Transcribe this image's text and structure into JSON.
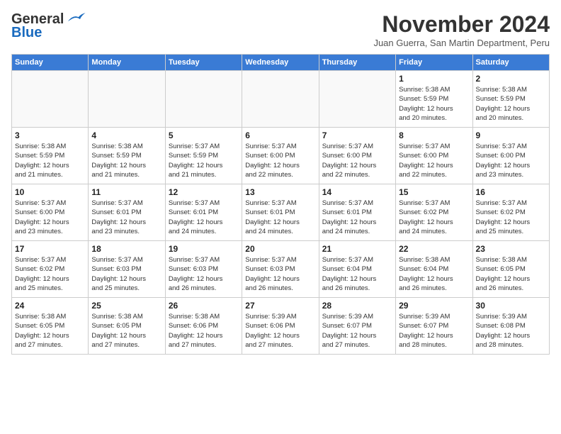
{
  "header": {
    "logo_line1": "General",
    "logo_line2": "Blue",
    "month": "November 2024",
    "location": "Juan Guerra, San Martin Department, Peru"
  },
  "weekdays": [
    "Sunday",
    "Monday",
    "Tuesday",
    "Wednesday",
    "Thursday",
    "Friday",
    "Saturday"
  ],
  "weeks": [
    [
      {
        "day": "",
        "info": ""
      },
      {
        "day": "",
        "info": ""
      },
      {
        "day": "",
        "info": ""
      },
      {
        "day": "",
        "info": ""
      },
      {
        "day": "",
        "info": ""
      },
      {
        "day": "1",
        "info": "Sunrise: 5:38 AM\nSunset: 5:59 PM\nDaylight: 12 hours\nand 20 minutes."
      },
      {
        "day": "2",
        "info": "Sunrise: 5:38 AM\nSunset: 5:59 PM\nDaylight: 12 hours\nand 20 minutes."
      }
    ],
    [
      {
        "day": "3",
        "info": "Sunrise: 5:38 AM\nSunset: 5:59 PM\nDaylight: 12 hours\nand 21 minutes."
      },
      {
        "day": "4",
        "info": "Sunrise: 5:38 AM\nSunset: 5:59 PM\nDaylight: 12 hours\nand 21 minutes."
      },
      {
        "day": "5",
        "info": "Sunrise: 5:37 AM\nSunset: 5:59 PM\nDaylight: 12 hours\nand 21 minutes."
      },
      {
        "day": "6",
        "info": "Sunrise: 5:37 AM\nSunset: 6:00 PM\nDaylight: 12 hours\nand 22 minutes."
      },
      {
        "day": "7",
        "info": "Sunrise: 5:37 AM\nSunset: 6:00 PM\nDaylight: 12 hours\nand 22 minutes."
      },
      {
        "day": "8",
        "info": "Sunrise: 5:37 AM\nSunset: 6:00 PM\nDaylight: 12 hours\nand 22 minutes."
      },
      {
        "day": "9",
        "info": "Sunrise: 5:37 AM\nSunset: 6:00 PM\nDaylight: 12 hours\nand 23 minutes."
      }
    ],
    [
      {
        "day": "10",
        "info": "Sunrise: 5:37 AM\nSunset: 6:00 PM\nDaylight: 12 hours\nand 23 minutes."
      },
      {
        "day": "11",
        "info": "Sunrise: 5:37 AM\nSunset: 6:01 PM\nDaylight: 12 hours\nand 23 minutes."
      },
      {
        "day": "12",
        "info": "Sunrise: 5:37 AM\nSunset: 6:01 PM\nDaylight: 12 hours\nand 24 minutes."
      },
      {
        "day": "13",
        "info": "Sunrise: 5:37 AM\nSunset: 6:01 PM\nDaylight: 12 hours\nand 24 minutes."
      },
      {
        "day": "14",
        "info": "Sunrise: 5:37 AM\nSunset: 6:01 PM\nDaylight: 12 hours\nand 24 minutes."
      },
      {
        "day": "15",
        "info": "Sunrise: 5:37 AM\nSunset: 6:02 PM\nDaylight: 12 hours\nand 24 minutes."
      },
      {
        "day": "16",
        "info": "Sunrise: 5:37 AM\nSunset: 6:02 PM\nDaylight: 12 hours\nand 25 minutes."
      }
    ],
    [
      {
        "day": "17",
        "info": "Sunrise: 5:37 AM\nSunset: 6:02 PM\nDaylight: 12 hours\nand 25 minutes."
      },
      {
        "day": "18",
        "info": "Sunrise: 5:37 AM\nSunset: 6:03 PM\nDaylight: 12 hours\nand 25 minutes."
      },
      {
        "day": "19",
        "info": "Sunrise: 5:37 AM\nSunset: 6:03 PM\nDaylight: 12 hours\nand 26 minutes."
      },
      {
        "day": "20",
        "info": "Sunrise: 5:37 AM\nSunset: 6:03 PM\nDaylight: 12 hours\nand 26 minutes."
      },
      {
        "day": "21",
        "info": "Sunrise: 5:37 AM\nSunset: 6:04 PM\nDaylight: 12 hours\nand 26 minutes."
      },
      {
        "day": "22",
        "info": "Sunrise: 5:38 AM\nSunset: 6:04 PM\nDaylight: 12 hours\nand 26 minutes."
      },
      {
        "day": "23",
        "info": "Sunrise: 5:38 AM\nSunset: 6:05 PM\nDaylight: 12 hours\nand 26 minutes."
      }
    ],
    [
      {
        "day": "24",
        "info": "Sunrise: 5:38 AM\nSunset: 6:05 PM\nDaylight: 12 hours\nand 27 minutes."
      },
      {
        "day": "25",
        "info": "Sunrise: 5:38 AM\nSunset: 6:05 PM\nDaylight: 12 hours\nand 27 minutes."
      },
      {
        "day": "26",
        "info": "Sunrise: 5:38 AM\nSunset: 6:06 PM\nDaylight: 12 hours\nand 27 minutes."
      },
      {
        "day": "27",
        "info": "Sunrise: 5:39 AM\nSunset: 6:06 PM\nDaylight: 12 hours\nand 27 minutes."
      },
      {
        "day": "28",
        "info": "Sunrise: 5:39 AM\nSunset: 6:07 PM\nDaylight: 12 hours\nand 27 minutes."
      },
      {
        "day": "29",
        "info": "Sunrise: 5:39 AM\nSunset: 6:07 PM\nDaylight: 12 hours\nand 28 minutes."
      },
      {
        "day": "30",
        "info": "Sunrise: 5:39 AM\nSunset: 6:08 PM\nDaylight: 12 hours\nand 28 minutes."
      }
    ]
  ]
}
